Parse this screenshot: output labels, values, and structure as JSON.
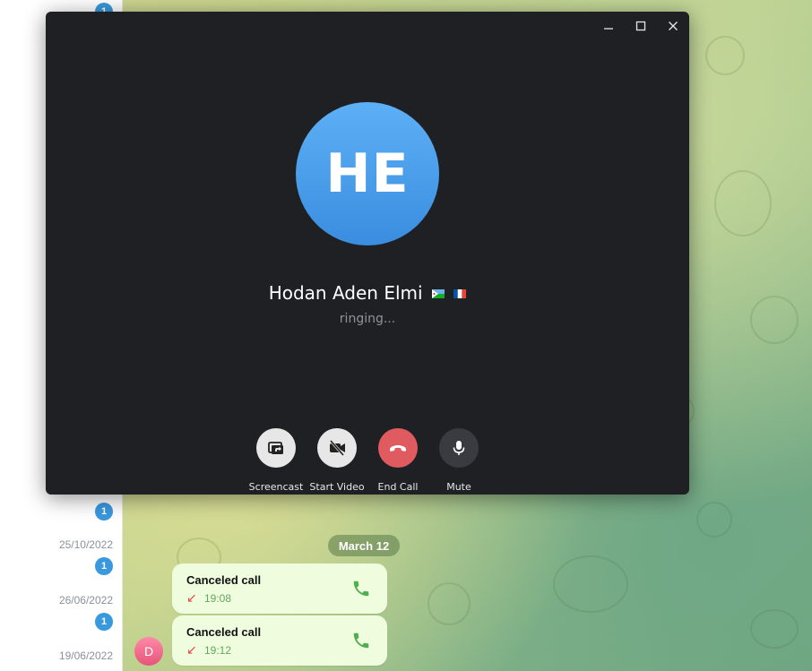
{
  "chat_list": {
    "badges": [
      "1",
      "1",
      "1",
      "1"
    ],
    "dates": [
      "25/10/2022",
      "26/06/2022",
      "19/06/2022"
    ]
  },
  "call_window": {
    "avatar_initials": "HE",
    "caller_name": "Hodan Aden Elmi",
    "status": "ringing...",
    "controls": [
      {
        "label": "Screencast",
        "icon": "screencast-icon"
      },
      {
        "label": "Start Video",
        "icon": "video-off-icon"
      },
      {
        "label": "End Call",
        "icon": "end-call-icon"
      },
      {
        "label": "Mute",
        "icon": "microphone-icon"
      }
    ],
    "colors": {
      "end_call": "#e05b5f",
      "control_light": "#e7e7e7",
      "control_dark": "#3a3b40",
      "avatar": "#4a9de8"
    }
  },
  "chat": {
    "date_separator": "March 12",
    "messages": [
      {
        "title": "Canceled call",
        "time": "19:08"
      },
      {
        "title": "Canceled call",
        "time": "19:12"
      }
    ],
    "sender_avatar_initial": "D"
  }
}
